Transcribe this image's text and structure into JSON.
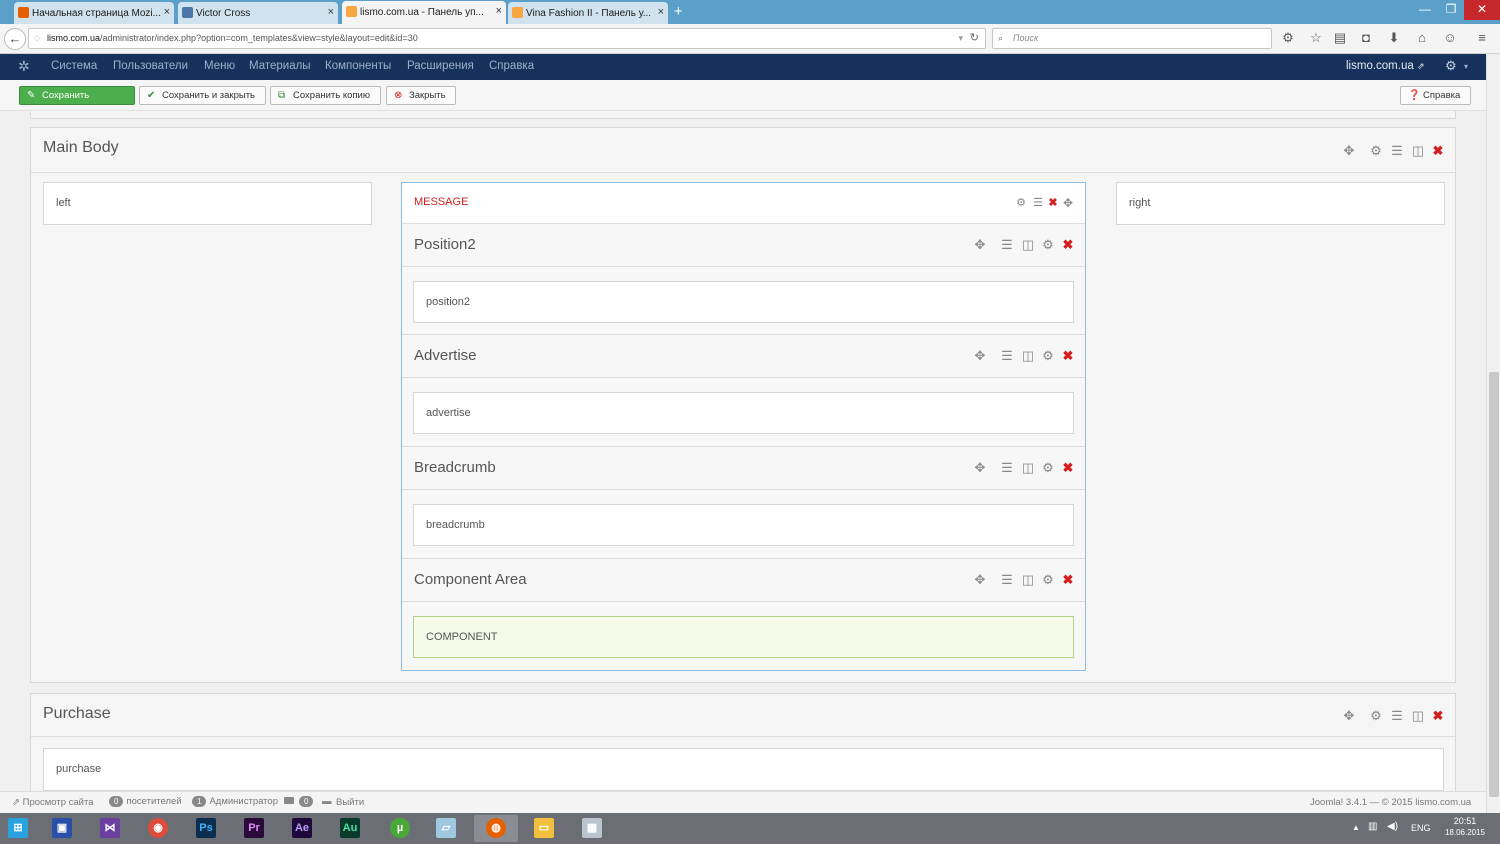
{
  "browser": {
    "tabs": [
      {
        "label": "Начальная страница Mozi...",
        "icon": "firefox-icon",
        "active": false
      },
      {
        "label": "Victor Cross",
        "icon": "vk-icon",
        "active": false
      },
      {
        "label": "lismo.com.ua - Панель уп...",
        "icon": "joomla-icon",
        "active": true
      },
      {
        "label": "Vina Fashion II - Панель у...",
        "icon": "joomla-icon",
        "active": false
      }
    ],
    "new_tab": "+",
    "url_host": "lismo.com.ua",
    "url_path": "/administrator/index.php?option=com_templates&view=style&layout=edit&id=30",
    "search_placeholder": "Поиск"
  },
  "joomla": {
    "menu": [
      "Система",
      "Пользователи",
      "Меню",
      "Материалы",
      "Компоненты",
      "Расширения",
      "Справка"
    ],
    "site_link": "lismo.com.ua",
    "toolbar": {
      "save": "Сохранить",
      "save_close": "Сохранить и закрыть",
      "save_copy": "Сохранить копию",
      "close": "Закрыть",
      "help": "Справка"
    }
  },
  "layout": {
    "main_body": {
      "title": "Main Body",
      "left": "left",
      "right": "right",
      "message": "MESSAGE",
      "rows": [
        {
          "title": "Position2",
          "module": "position2"
        },
        {
          "title": "Advertise",
          "module": "advertise"
        },
        {
          "title": "Breadcrumb",
          "module": "breadcrumb"
        },
        {
          "title": "Component Area",
          "module": "COMPONENT"
        }
      ]
    },
    "purchase": {
      "title": "Purchase",
      "module": "purchase"
    }
  },
  "status": {
    "view_site": "Просмотр сайта",
    "visitors_count": "0",
    "visitors_label": "посетителей",
    "admins_count": "1",
    "admins_label": "Администратор",
    "messages_count": "0",
    "logout": "Выйти",
    "footer": "Joomla! 3.4.1 — © 2015 lismo.com.ua"
  },
  "taskbar": {
    "lang": "ENG",
    "time": "20:51",
    "date": "18.06.2015"
  },
  "colors": {
    "joomla_header": "#16325c",
    "save_green": "#4cae4c",
    "component_bg": "#f6fbe9",
    "delete_red": "#d21e1e"
  }
}
